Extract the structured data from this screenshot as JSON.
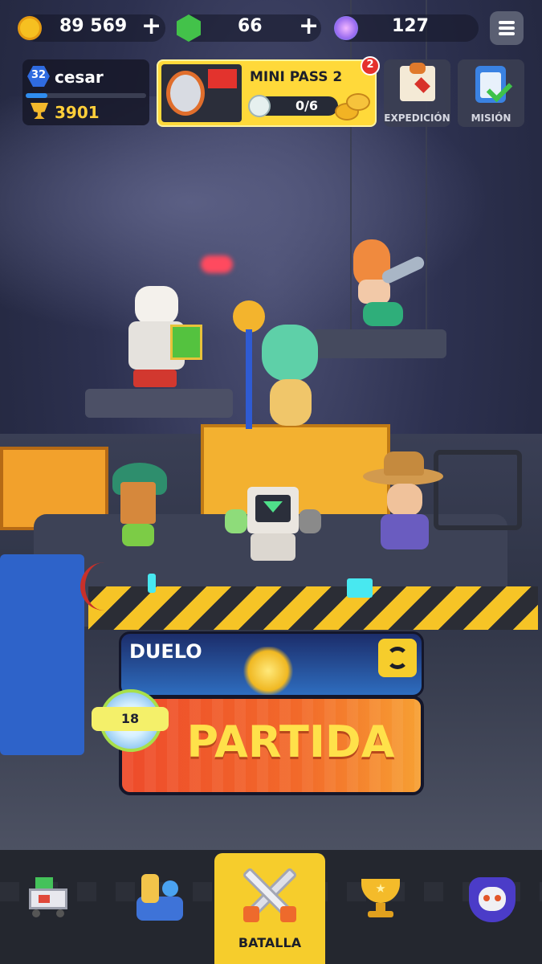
{
  "currencies": {
    "coins": {
      "value": "89 569",
      "icon": "gold-coin-icon"
    },
    "gems": {
      "value": "66",
      "icon": "green-gem-icon"
    },
    "tokens": {
      "value": "127",
      "icon": "purple-orb-icon"
    }
  },
  "profile": {
    "level": "32",
    "name": "cesar",
    "trophies": "3901"
  },
  "pass": {
    "title": "MINI PASS 2",
    "progress": "0/6",
    "notification": "2",
    "progress_fraction": 0.0
  },
  "side_buttons": {
    "expedicion": "EXPEDICIÓN",
    "mision": "MISIÓN"
  },
  "play": {
    "mode": "DUELO",
    "action": "PARTIDA",
    "level": "18"
  },
  "nav": {
    "active_label": "BATALLA"
  },
  "colors": {
    "accent_yellow": "#ffd93a",
    "play_orange": "#f26a2a",
    "nav_bg": "#24272f"
  }
}
